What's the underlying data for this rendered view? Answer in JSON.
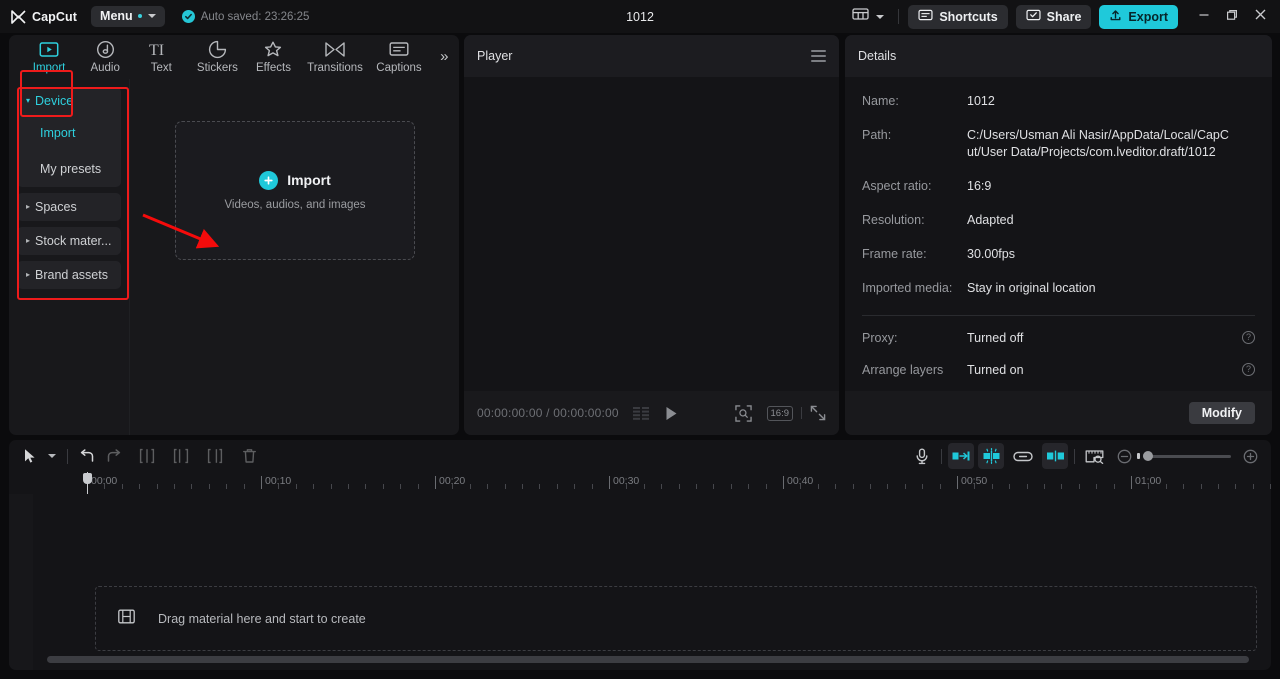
{
  "titlebar": {
    "brand": "CapCut",
    "menu_label": "Menu",
    "autosave_text": "Auto saved: 23:26:25",
    "project_title": "1012",
    "shortcuts_label": "Shortcuts",
    "share_label": "Share",
    "export_label": "Export",
    "icons": {
      "logo": "capcut-logo-icon",
      "autosave_check": "check-circle-icon",
      "layout": "layout-grid-icon",
      "layout_caret": "chevron-down-icon",
      "shortcuts": "keyboard-icon",
      "share": "share-screen-icon",
      "export": "upload-icon",
      "minimize": "minimize-icon",
      "maximize": "restore-icon",
      "close": "close-icon"
    }
  },
  "left_panel": {
    "tabs": [
      {
        "label": "Import",
        "icon": "import-video-icon",
        "active": true
      },
      {
        "label": "Audio",
        "icon": "audio-note-icon",
        "active": false
      },
      {
        "label": "Text",
        "icon": "text-ti-icon",
        "active": false
      },
      {
        "label": "Stickers",
        "icon": "sticker-circle-icon",
        "active": false
      },
      {
        "label": "Effects",
        "icon": "effects-sparkle-icon",
        "active": false
      },
      {
        "label": "Transitions",
        "icon": "transitions-bowtie-icon",
        "active": false
      },
      {
        "label": "Captions",
        "icon": "captions-box-icon",
        "active": false
      }
    ],
    "more_label": "»",
    "nav": [
      {
        "label": "Device",
        "type": "group",
        "open": true,
        "tri": "▾"
      },
      {
        "label": "Import",
        "type": "sub",
        "active": true
      },
      {
        "label": "My presets",
        "type": "sub",
        "active": false
      },
      {
        "label": "Spaces",
        "type": "group",
        "open": false,
        "tri": "▸"
      },
      {
        "label": "Stock mater...",
        "type": "group",
        "open": false,
        "tri": "▸"
      },
      {
        "label": "Brand assets",
        "type": "group",
        "open": false,
        "tri": "▸"
      }
    ],
    "dropzone": {
      "title": "Import",
      "subtitle": "Videos, audios, and images",
      "plus_icon": "plus-circle-icon"
    }
  },
  "player": {
    "title": "Player",
    "menu_icon": "hamburger-menu-icon",
    "timecode": "00:00:00:00 / 00:00:00:00",
    "icons": {
      "quality": "quality-bars-icon",
      "play": "play-icon",
      "crop": "crop-zoom-icon",
      "fullscreen": "fullscreen-icon"
    },
    "ratio_label": "16:9"
  },
  "details": {
    "title": "Details",
    "rows": [
      {
        "key": "Name:",
        "value": "1012",
        "help": false
      },
      {
        "key": "Path:",
        "value": "C:/Users/Usman Ali Nasir/AppData/Local/CapCut/User Data/Projects/com.lveditor.draft/1012",
        "help": false
      },
      {
        "key": "Aspect ratio:",
        "value": "16:9",
        "help": false
      },
      {
        "key": "Resolution:",
        "value": "Adapted",
        "help": false
      },
      {
        "key": "Frame rate:",
        "value": "30.00fps",
        "help": false
      },
      {
        "key": "Imported media:",
        "value": "Stay in original location",
        "help": false
      }
    ],
    "toggle_rows": [
      {
        "key": "Proxy:",
        "value": "Turned off",
        "help": true,
        "help_glyph": "?"
      },
      {
        "key": "Arrange layers",
        "value": "Turned on",
        "help": true,
        "help_glyph": "?"
      }
    ],
    "modify_label": "Modify"
  },
  "timeline": {
    "tools_left": [
      {
        "name": "select-arrow-icon",
        "state": "enabled"
      },
      {
        "name": "chevron-down-icon",
        "state": "enabled"
      },
      {
        "name": "undo-icon",
        "state": "enabled"
      },
      {
        "name": "redo-icon",
        "state": "disabled"
      },
      {
        "name": "split-icon",
        "state": "disabled"
      },
      {
        "name": "trim-left-icon",
        "state": "disabled"
      },
      {
        "name": "trim-right-icon",
        "state": "disabled"
      },
      {
        "name": "delete-icon",
        "state": "disabled"
      }
    ],
    "tools_right": [
      {
        "name": "microphone-icon",
        "state": "enabled"
      },
      {
        "name": "auto-cut-icon",
        "state": "active"
      },
      {
        "name": "keyframe-icon",
        "state": "active"
      },
      {
        "name": "link-icon",
        "state": "enabled"
      },
      {
        "name": "mirror-icon",
        "state": "active"
      },
      {
        "name": "ruler-zoom-icon",
        "state": "enabled"
      },
      {
        "name": "zoom-out-icon",
        "state": "enabled"
      },
      {
        "name": "zoom-in-icon",
        "state": "enabled"
      }
    ],
    "ruler_labels": [
      "00:00",
      "00:10",
      "00:20",
      "00:30",
      "00:40",
      "00:50",
      "01:00"
    ],
    "playhead_time": "00:00",
    "drag_hint": "Drag material here and start to create",
    "drag_icon": "film-strip-icon"
  },
  "annotations": {
    "highlight_color": "#ef1b1b",
    "arrow_color": "#f50b0b",
    "highlights": [
      "import-tab",
      "device-nav-group"
    ]
  },
  "theme": {
    "accent": "#1fc9da",
    "bg": "#0b0b0d",
    "panel": "#141417",
    "panel_alt": "#18181b",
    "header": "#1c1c20",
    "text": "#dfe0e3",
    "text_dim": "#97999e"
  }
}
